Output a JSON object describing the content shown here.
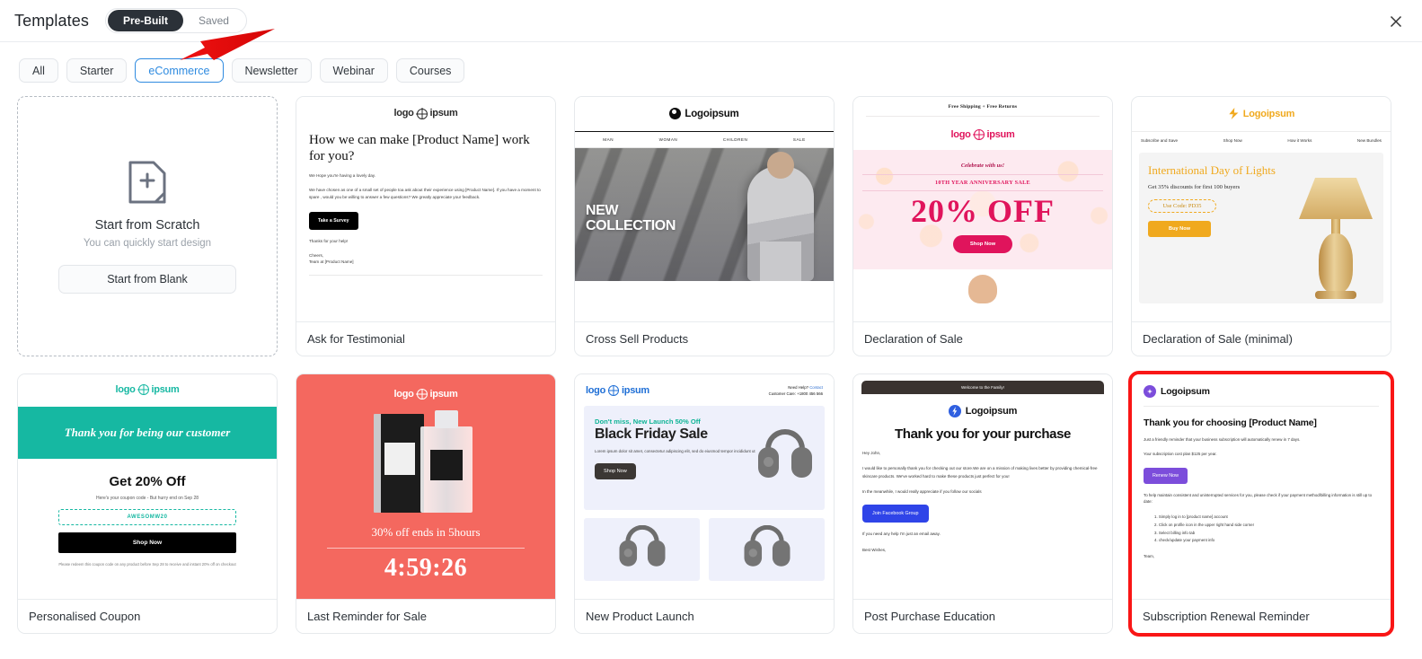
{
  "header": {
    "title": "Templates",
    "toggle": {
      "prebuilt": "Pre-Built",
      "saved": "Saved"
    },
    "close_icon": "close-icon"
  },
  "filters": [
    {
      "label": "All",
      "selected": false
    },
    {
      "label": "Starter",
      "selected": false
    },
    {
      "label": "eCommerce",
      "selected": true
    },
    {
      "label": "Newsletter",
      "selected": false
    },
    {
      "label": "Webinar",
      "selected": false
    },
    {
      "label": "Courses",
      "selected": false
    }
  ],
  "accent_colors": {
    "selected_chip": "#2f8be0",
    "selected_card_border": "#f91616",
    "annotation_arrow": "#ee1111",
    "toggle_active_bg": "#2b3138"
  },
  "scratch": {
    "title": "Start from Scratch",
    "subtitle": "You can quickly start design",
    "button": "Start from Blank",
    "icon": "document-plus-icon"
  },
  "templates": [
    {
      "id": "ask-for-testimonial",
      "title": "Ask for Testimonial",
      "selected": false,
      "logo": "logo ipsum",
      "heading": "How we can make [Product Name] work for you?",
      "para1": "We Hope you're having a lovely day.",
      "para2": "We have chosen as one of a small set of people toa ask about their experience using [Product Name]. If you have a moment to spare , would you be willing to answer a few questions? We greatly appreciate your feedback.",
      "cta": "Take a Survey",
      "thanks": "Thanks for your help!",
      "signoff1": "Cheers,",
      "signoff2": "Team at [Product Name]"
    },
    {
      "id": "cross-sell-products",
      "title": "Cross Sell Products",
      "selected": false,
      "logo": "Logoipsum",
      "nav": [
        "MAN",
        "WOMAN",
        "CHILDREN",
        "SALE"
      ],
      "hero_line1": "NEW",
      "hero_line2": "COLLECTION"
    },
    {
      "id": "declaration-of-sale",
      "title": "Declaration of Sale",
      "selected": false,
      "shipping_bar": "Free Shipping  +  Free Returns",
      "logo": "logo ipsum",
      "celebrate": "Celebrate with us!",
      "anniversary": "10TH YEAR ANNIVERSARY SALE",
      "discount": "20% OFF",
      "cta": "Shop Now"
    },
    {
      "id": "declaration-of-sale-minimal",
      "title": "Declaration of Sale (minimal)",
      "selected": false,
      "logo": "Logoipsum",
      "nav": [
        "Subscribe and Save",
        "Shop Now",
        "How it Works",
        "New Bundles"
      ],
      "heading": "International Day of Lights",
      "subheading": "Get 35% discounts for first 100 buyers",
      "code": "Use Code: PD35",
      "cta": "Buy Now"
    },
    {
      "id": "personalised-coupon",
      "title": "Personalised Coupon",
      "selected": false,
      "logo": "logo ipsum",
      "banner": "Thank you for being our customer",
      "heading": "Get 20% Off",
      "subheading": "Here's your coupon code - But hurry end on  Sep 28",
      "code": "AWESOMW20",
      "cta": "Shop Now",
      "footnote": "Please redeem this coupon code on any product before Sep 28 to receive and instant 20% off on checkout"
    },
    {
      "id": "last-reminder-for-sale",
      "title": "Last Reminder for Sale",
      "selected": false,
      "logo": "logo ipsum",
      "subheading": "30% off ends in 5hours",
      "timer": "4:59:26"
    },
    {
      "id": "new-product-launch",
      "title": "New Product Launch",
      "selected": false,
      "logo": "logo ipsum",
      "help_line1_prefix": "Need Help? ",
      "help_link": "Contact",
      "help_line2": "Customer Care: +1800 456 566",
      "kicker": "Don't miss, New Launch 50% Off",
      "heading": "Black Friday Sale",
      "para": "Lorem ipsum dolor sit amet, consectetur adipiscing elit, sed do eiusmod tempor incididunt ut",
      "cta": "Shop Now"
    },
    {
      "id": "post-purchase-education",
      "title": "Post Purchase Education",
      "selected": false,
      "topbar": "Welcome to the Family!",
      "logo": "Logoipsum",
      "heading": "Thank you for your purchase",
      "greeting": "Hey John,",
      "para1": "I would like to personally thank you for checking out our store.We are on a mission of making lives better by providing chemical-free skincare products. We've worked hard to make these products just perfect for you!",
      "para2": "In the meanwhile, I would really appreciate if you follow our socials",
      "cta": "Join Facebook Group",
      "para3": "If you need any help I'm just an email away.",
      "signoff": "Best Wishes,"
    },
    {
      "id": "subscription-renewal-reminder",
      "title": "Subscription Renewal Reminder",
      "selected": true,
      "logo": "Logoipsum",
      "heading": "Thank you for choosing [Product Name]",
      "para1": "Just a friendly reminder that your business subscription will automatically renew in 7 days.",
      "para2": "Your subscription cost plan $125 per year.",
      "cta": "Renew Now",
      "para3": "To help maintain consistent and uninterrupted services for you, please check if your payment method/billing information is still up to date:",
      "steps": [
        "1. Simply log in to [product name] account",
        "2. Click on profile icon in the upper right hand side corner",
        "3. Select billing info tab",
        "4. check/update your payment info"
      ],
      "signoff": "Team,"
    }
  ]
}
